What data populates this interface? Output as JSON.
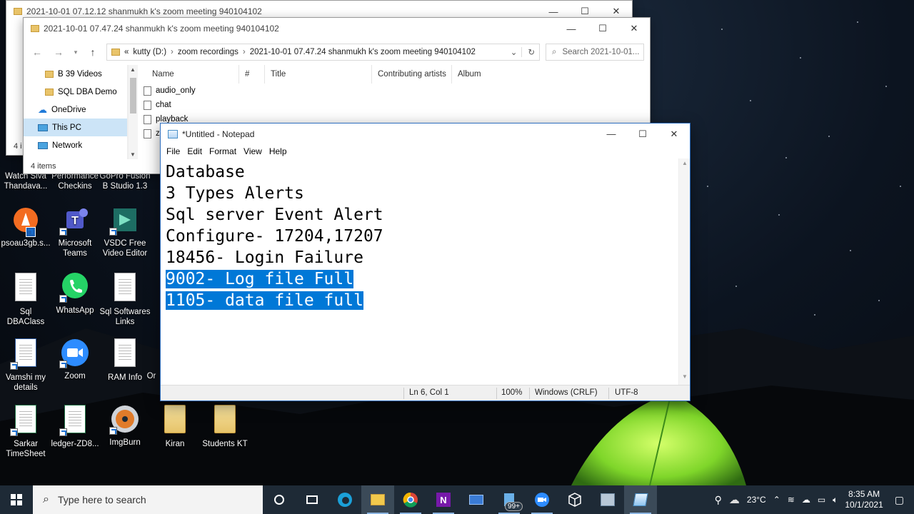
{
  "explorer_back": {
    "title": "2021-10-01 07.12.12 shanmukh k's zoom meeting 940104102",
    "status": "4 i"
  },
  "explorer": {
    "title": "2021-10-01 07.47.24 shanmukh k's zoom meeting 940104102",
    "breadcrumb": [
      "«",
      "kutty (D:)",
      "zoom recordings",
      "2021-10-01 07.47.24 shanmukh k's zoom meeting 940104102"
    ],
    "search_placeholder": "Search 2021-10-01...",
    "nav_items": [
      "B 39 Videos",
      "SQL DBA Demo",
      "OneDrive",
      "This PC",
      "Network"
    ],
    "columns": [
      "Name",
      "#",
      "Title",
      "Contributing artists",
      "Album"
    ],
    "files": [
      "audio_only",
      "chat",
      "playback",
      "zo"
    ],
    "status": "4 items"
  },
  "notepad": {
    "title": "*Untitled - Notepad",
    "menu": [
      "File",
      "Edit",
      "Format",
      "View",
      "Help"
    ],
    "lines": [
      "Database",
      "3 Types Alerts",
      "Sql server Event Alert",
      "Configure- 17204,17207",
      "18456- Login Failure",
      "9002- Log file Full",
      "1105- data file full"
    ],
    "status": {
      "position": "Ln 6, Col 1",
      "zoom": "100%",
      "line_ending": "Windows (CRLF)",
      "encoding": "UTF-8"
    }
  },
  "desktop_icons": [
    "Watch Siva Thandava...",
    "Performance Checkins",
    "GoPro Fusion B Studio 1.3",
    "psoau3gb.s...",
    "Microsoft Teams",
    "VSDC Free Video Editor",
    "Sql DBAClass",
    "WhatsApp",
    "Sql Softwares Links",
    "Vamshi my details",
    "Zoom",
    "RAM Info",
    "Or",
    "Sarkar TimeSheet",
    "ledger-ZD8...",
    "ImgBurn",
    "Kiran",
    "Students KT"
  ],
  "taskbar": {
    "search_placeholder": "Type here to search",
    "badge": "99+",
    "weather": "23°C",
    "time": "8:35 AM",
    "date": "10/1/2021"
  },
  "colors": {
    "selection": "#0078d7",
    "taskbar": "#1e2a36",
    "tent_green": "#7fd62a"
  }
}
